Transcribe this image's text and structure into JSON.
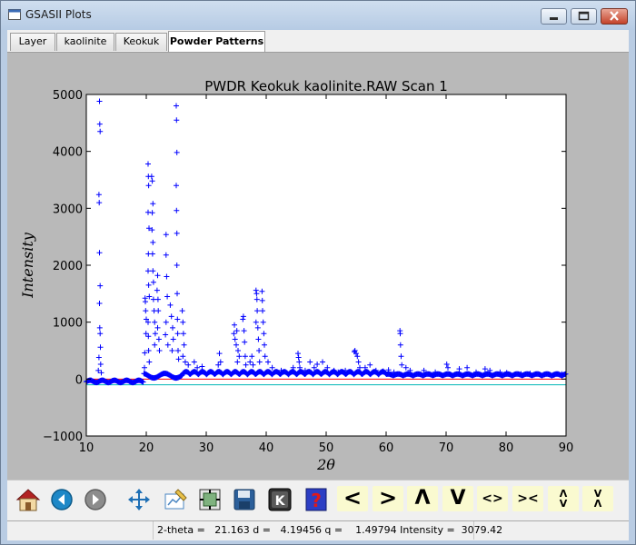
{
  "window": {
    "title": "GSASII Plots"
  },
  "tabs": [
    {
      "label": "Layer",
      "active": false
    },
    {
      "label": "kaolinite",
      "active": false
    },
    {
      "label": "Keokuk",
      "active": false
    },
    {
      "label": "Powder Patterns",
      "active": true
    }
  ],
  "toolbar": {
    "buttons": [
      {
        "name": "home-icon"
      },
      {
        "name": "back-icon"
      },
      {
        "name": "forward-icon"
      },
      {
        "name": "pan-icon"
      },
      {
        "name": "edit-axes-icon"
      },
      {
        "name": "configure-subplots-icon"
      },
      {
        "name": "save-icon"
      },
      {
        "name": "key-help-icon"
      },
      {
        "name": "help-icon"
      }
    ],
    "shift_buttons": [
      {
        "name": "shift-left-button",
        "label": "<"
      },
      {
        "name": "shift-right-button",
        "label": ">"
      },
      {
        "name": "shift-up-button",
        "label": "Λ"
      },
      {
        "name": "shift-down-button",
        "label": "V"
      },
      {
        "name": "expand-x-button",
        "label": "<>"
      },
      {
        "name": "shrink-x-button",
        "label": "><"
      },
      {
        "name": "expand-y-button",
        "label": "Λ\nV"
      },
      {
        "name": "shrink-y-button",
        "label": "V\nΛ"
      }
    ]
  },
  "status": {
    "text": "2-theta =   21.163 d =   4.19456 q =    1.49794 Intensity =  3079.42"
  },
  "chart_data": {
    "type": "scatter",
    "title": "PWDR Keokuk kaolinite.RAW Scan 1",
    "xlabel": "2θ",
    "ylabel": "Intensity",
    "xlim": [
      10,
      90
    ],
    "ylim": [
      -1000,
      5000
    ],
    "xticks": [
      "10",
      "20",
      "30",
      "40",
      "50",
      "60",
      "70",
      "80",
      "90"
    ],
    "yticks": [
      "−1000",
      "0",
      "1000",
      "2000",
      "3000",
      "4000",
      "5000"
    ],
    "marker": "+",
    "color": "#0000ff",
    "background_line": {
      "y": 0,
      "color": "#ff0000"
    },
    "difference_line": {
      "y": -100,
      "color": "#00b7b7"
    },
    "baseline": 30,
    "points": [
      [
        12.2,
        4880
      ],
      [
        12.25,
        4480
      ],
      [
        12.3,
        4350
      ],
      [
        12.1,
        3240
      ],
      [
        12.15,
        3100
      ],
      [
        12.2,
        2220
      ],
      [
        12.3,
        1640
      ],
      [
        12.2,
        1330
      ],
      [
        12.25,
        900
      ],
      [
        12.3,
        800
      ],
      [
        12.35,
        560
      ],
      [
        12.1,
        380
      ],
      [
        12.4,
        260
      ],
      [
        12.0,
        150
      ],
      [
        12.5,
        110
      ],
      [
        19.8,
        1420
      ],
      [
        19.85,
        1360
      ],
      [
        19.9,
        1200
      ],
      [
        20.0,
        1050
      ],
      [
        19.95,
        800
      ],
      [
        19.75,
        460
      ],
      [
        19.7,
        200
      ],
      [
        20.3,
        3780
      ],
      [
        20.35,
        3560
      ],
      [
        20.4,
        3400
      ],
      [
        20.3,
        2930
      ],
      [
        20.45,
        2650
      ],
      [
        20.35,
        2200
      ],
      [
        20.3,
        1900
      ],
      [
        20.4,
        1650
      ],
      [
        20.5,
        1450
      ],
      [
        20.3,
        1000
      ],
      [
        20.35,
        750
      ],
      [
        20.4,
        500
      ],
      [
        20.5,
        300
      ],
      [
        20.9,
        3560
      ],
      [
        21.0,
        3480
      ],
      [
        21.1,
        3080
      ],
      [
        21.0,
        2920
      ],
      [
        20.95,
        2620
      ],
      [
        21.1,
        2400
      ],
      [
        21.05,
        2200
      ],
      [
        21.1,
        1900
      ],
      [
        21.2,
        1700
      ],
      [
        21.2,
        1400
      ],
      [
        21.3,
        1200
      ],
      [
        21.4,
        1000
      ],
      [
        21.5,
        800
      ],
      [
        21.4,
        600
      ],
      [
        21.9,
        1820
      ],
      [
        21.8,
        1560
      ],
      [
        21.95,
        1400
      ],
      [
        22.0,
        1200
      ],
      [
        21.9,
        900
      ],
      [
        22.1,
        700
      ],
      [
        22.2,
        500
      ],
      [
        23.3,
        2540
      ],
      [
        23.3,
        2180
      ],
      [
        23.4,
        1800
      ],
      [
        23.5,
        1450
      ],
      [
        23.3,
        1000
      ],
      [
        23.2,
        780
      ],
      [
        23.6,
        600
      ],
      [
        24.0,
        1300
      ],
      [
        24.2,
        1100
      ],
      [
        24.4,
        900
      ],
      [
        24.5,
        700
      ],
      [
        24.3,
        500
      ],
      [
        25.0,
        4800
      ],
      [
        25.05,
        4550
      ],
      [
        25.1,
        3980
      ],
      [
        25.0,
        3400
      ],
      [
        25.05,
        2960
      ],
      [
        25.1,
        2560
      ],
      [
        25.1,
        2000
      ],
      [
        25.15,
        1500
      ],
      [
        25.2,
        1050
      ],
      [
        25.25,
        800
      ],
      [
        25.3,
        500
      ],
      [
        25.4,
        350
      ],
      [
        26.0,
        1200
      ],
      [
        26.1,
        1000
      ],
      [
        26.2,
        800
      ],
      [
        26.3,
        600
      ],
      [
        26.1,
        400
      ],
      [
        26.5,
        300
      ],
      [
        27.0,
        250
      ],
      [
        28.0,
        300
      ],
      [
        28.5,
        200
      ],
      [
        29.3,
        220
      ],
      [
        32.0,
        250
      ],
      [
        32.2,
        450
      ],
      [
        32.4,
        300
      ],
      [
        34.6,
        800
      ],
      [
        34.7,
        950
      ],
      [
        34.8,
        700
      ],
      [
        35.0,
        600
      ],
      [
        35.1,
        850
      ],
      [
        35.3,
        500
      ],
      [
        35.5,
        400
      ],
      [
        35.2,
        300
      ],
      [
        36.1,
        1050
      ],
      [
        36.2,
        1100
      ],
      [
        36.3,
        850
      ],
      [
        36.4,
        650
      ],
      [
        36.5,
        400
      ],
      [
        36.6,
        250
      ],
      [
        37.3,
        300
      ],
      [
        37.6,
        400
      ],
      [
        37.8,
        250
      ],
      [
        38.3,
        1560
      ],
      [
        38.4,
        1500
      ],
      [
        38.45,
        1400
      ],
      [
        38.5,
        1200
      ],
      [
        38.3,
        1000
      ],
      [
        38.6,
        900
      ],
      [
        38.7,
        700
      ],
      [
        38.8,
        500
      ],
      [
        38.9,
        300
      ],
      [
        39.3,
        1540
      ],
      [
        39.35,
        1380
      ],
      [
        39.4,
        1200
      ],
      [
        39.5,
        1000
      ],
      [
        39.6,
        800
      ],
      [
        39.7,
        600
      ],
      [
        39.8,
        400
      ],
      [
        40.3,
        300
      ],
      [
        41.0,
        200
      ],
      [
        42.5,
        150
      ],
      [
        44.5,
        200
      ],
      [
        45.3,
        450
      ],
      [
        45.4,
        380
      ],
      [
        45.5,
        300
      ],
      [
        45.6,
        200
      ],
      [
        46.5,
        150
      ],
      [
        47.3,
        300
      ],
      [
        48.0,
        200
      ],
      [
        48.5,
        260
      ],
      [
        49.4,
        300
      ],
      [
        50.2,
        200
      ],
      [
        51.3,
        150
      ],
      [
        52.0,
        120
      ],
      [
        53.2,
        150
      ],
      [
        54.7,
        480
      ],
      [
        54.8,
        500
      ],
      [
        55.0,
        450
      ],
      [
        55.2,
        400
      ],
      [
        55.4,
        300
      ],
      [
        55.6,
        200
      ],
      [
        56.5,
        200
      ],
      [
        57.3,
        250
      ],
      [
        58.3,
        150
      ],
      [
        59.5,
        140
      ],
      [
        60.4,
        160
      ],
      [
        61.3,
        120
      ],
      [
        62.3,
        850
      ],
      [
        62.35,
        800
      ],
      [
        62.4,
        600
      ],
      [
        62.5,
        400
      ],
      [
        62.6,
        250
      ],
      [
        63.3,
        200
      ],
      [
        64.0,
        150
      ],
      [
        66.3,
        150
      ],
      [
        68.2,
        120
      ],
      [
        70.1,
        260
      ],
      [
        70.3,
        200
      ],
      [
        72.2,
        180
      ],
      [
        73.5,
        200
      ],
      [
        75.0,
        120
      ],
      [
        76.5,
        180
      ],
      [
        77.3,
        150
      ],
      [
        79.0,
        120
      ],
      [
        80.1,
        110
      ],
      [
        82.5,
        90
      ],
      [
        84.0,
        100
      ],
      [
        86.4,
        80
      ],
      [
        88.0,
        70
      ],
      [
        89.3,
        90
      ]
    ]
  }
}
